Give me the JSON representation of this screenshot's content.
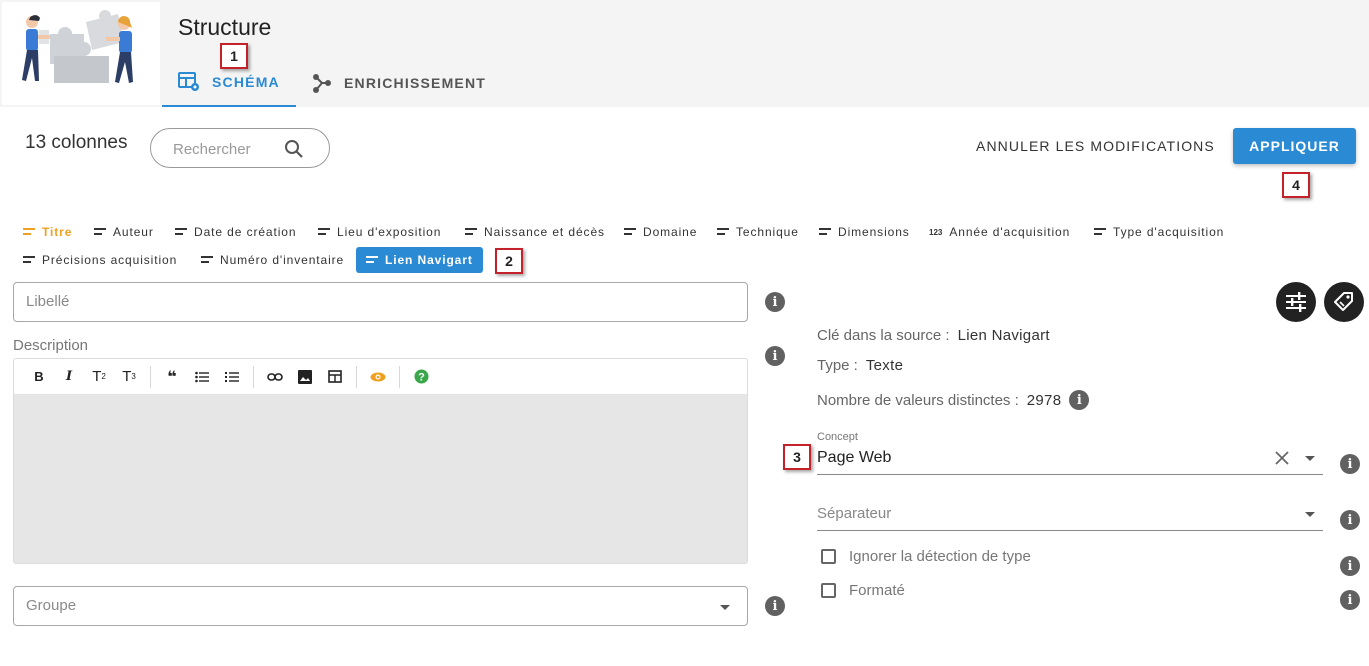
{
  "header": {
    "title": "Structure",
    "tabs": [
      {
        "label": "SCHÉMA",
        "icon": "table-settings-icon",
        "active": true
      },
      {
        "label": "ENRICHISSEMENT",
        "icon": "share-nodes-icon",
        "active": false
      }
    ]
  },
  "annotations": {
    "b1": "1",
    "b2": "2",
    "b3": "3",
    "b4": "4",
    "color": "#c4222b"
  },
  "toolbar": {
    "column_count": "13 colonnes",
    "search_placeholder": "Rechercher",
    "cancel_label": "ANNULER LES MODIFICATIONS",
    "apply_label": "APPLIQUER"
  },
  "columns": [
    {
      "label": "Titre",
      "icon": "text-lines-icon",
      "state": "title"
    },
    {
      "label": "Auteur",
      "icon": "text-lines-icon"
    },
    {
      "label": "Date de création",
      "icon": "text-lines-icon"
    },
    {
      "label": "Lieu d'exposition",
      "icon": "text-lines-icon"
    },
    {
      "label": "Naissance et décès",
      "icon": "text-lines-icon"
    },
    {
      "label": "Domaine",
      "icon": "text-lines-icon"
    },
    {
      "label": "Technique",
      "icon": "text-lines-icon"
    },
    {
      "label": "Dimensions",
      "icon": "text-lines-icon"
    },
    {
      "label": "Année d'acquisition",
      "icon": "numeric-123-icon",
      "icon_text": "123"
    },
    {
      "label": "Type d'acquisition",
      "icon": "text-lines-icon"
    },
    {
      "label": "Précisions acquisition",
      "icon": "text-lines-icon"
    },
    {
      "label": "Numéro d'inventaire",
      "icon": "text-lines-icon"
    },
    {
      "label": "Lien Navigart",
      "icon": "text-lines-icon",
      "state": "selected"
    }
  ],
  "form": {
    "libelle_placeholder": "Libellé",
    "description_label": "Description",
    "groupe_placeholder": "Groupe",
    "editor_tools": [
      "B",
      "I",
      "T",
      "2",
      "T",
      "3"
    ]
  },
  "details": {
    "source_key_label": "Clé dans la source :",
    "source_key_value": "Lien Navigart",
    "type_label": "Type :",
    "type_value": "Texte",
    "distinct_label": "Nombre de valeurs distinctes :",
    "distinct_value": "2978",
    "concept_label": "Concept",
    "concept_value": "Page Web",
    "separator_placeholder": "Séparateur",
    "ignore_type_label": "Ignorer la détection de type",
    "formatted_label": "Formaté"
  },
  "colors": {
    "accent": "#2a8ad3",
    "title_chip": "#f0a020",
    "dark_button": "#222222",
    "info_icon": "#616161"
  }
}
